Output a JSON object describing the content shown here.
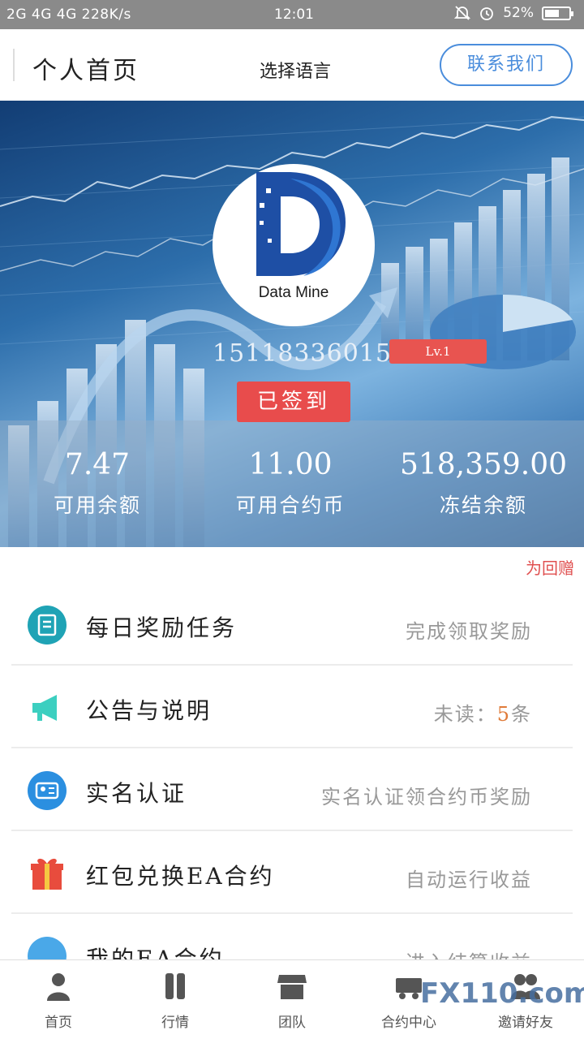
{
  "status_bar": {
    "network": "2G 4G 4G 228K/s",
    "time": "12:01",
    "battery": "52%"
  },
  "header": {
    "title": "个人首页",
    "language": "选择语言",
    "contact": "联系我们"
  },
  "profile": {
    "logo_text": "Data Mine",
    "phone": "15118336015",
    "level": "Lv.1",
    "checkin": "已签到"
  },
  "stats": [
    {
      "value": "7.47",
      "label": "可用余额"
    },
    {
      "value": "11.00",
      "label": "可用合约币"
    },
    {
      "value": "518,359.00",
      "label": "冻结余额"
    }
  ],
  "return_gift": "为回赠",
  "menu": [
    {
      "label": "每日奖励任务",
      "hint": "完成领取奖励",
      "icon": "task-icon"
    },
    {
      "label": "公告与说明",
      "hint_prefix": "未读：",
      "hint_count": "5",
      "hint_suffix": "条",
      "icon": "megaphone-icon"
    },
    {
      "label": "实名认证",
      "hint": "实名认证领合约币奖励",
      "icon": "id-card-icon"
    },
    {
      "label": "红包兑换EA合约",
      "hint": "自动运行收益",
      "icon": "gift-icon"
    },
    {
      "label": "我的EA合约",
      "hint": "进入结算收益",
      "icon": "contract-icon"
    }
  ],
  "nav": [
    {
      "label": "首页",
      "icon": "home-icon"
    },
    {
      "label": "行情",
      "icon": "market-icon"
    },
    {
      "label": "团队",
      "icon": "team-icon"
    },
    {
      "label": "合约中心",
      "icon": "contract-center-icon"
    },
    {
      "label": "邀请好友",
      "icon": "invite-icon"
    }
  ],
  "watermark": "FX110.com",
  "colors": {
    "accent": "#4a8ddc",
    "badge": "#e85450",
    "checkin": "#e84c4c",
    "count": "#e07b39",
    "teal": "#1fa3b5"
  }
}
